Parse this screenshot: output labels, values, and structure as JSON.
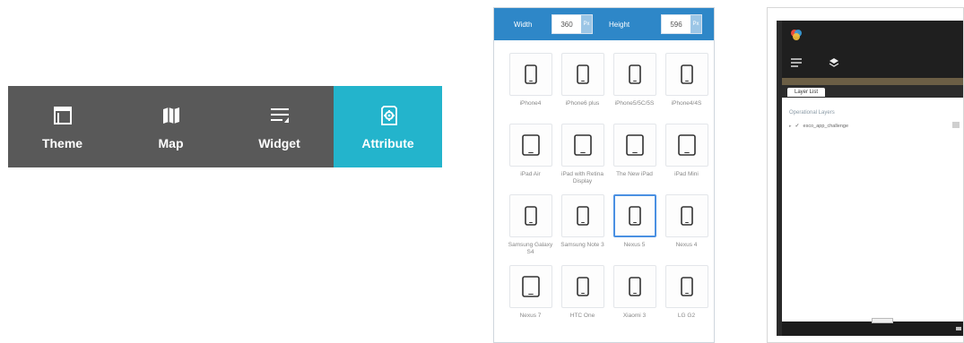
{
  "tabs": [
    {
      "label": "Theme",
      "icon": "theme-icon",
      "active": false
    },
    {
      "label": "Map",
      "icon": "map-icon",
      "active": false
    },
    {
      "label": "Widget",
      "icon": "widget-icon",
      "active": false
    },
    {
      "label": "Attribute",
      "icon": "attribute-gear-icon",
      "active": true
    }
  ],
  "size_bar": {
    "width_label": "Width",
    "width_value": "360",
    "width_unit": "Px",
    "height_label": "Height",
    "height_value": "596",
    "height_unit": "Px"
  },
  "devices": [
    {
      "label": "iPhone4",
      "type": "phone"
    },
    {
      "label": "iPhone6 plus",
      "type": "phone"
    },
    {
      "label": "iPhone5/5C/5S",
      "type": "phone"
    },
    {
      "label": "iPhone4/4S",
      "type": "phone"
    },
    {
      "label": "iPad Air",
      "type": "tablet"
    },
    {
      "label": "iPad with Retina Display",
      "type": "tablet"
    },
    {
      "label": "The New iPad",
      "type": "tablet"
    },
    {
      "label": "iPad Mini",
      "type": "tablet"
    },
    {
      "label": "Samsung Galaxy S4",
      "type": "phone"
    },
    {
      "label": "Samsung Note 3",
      "type": "phone"
    },
    {
      "label": "Nexus 5",
      "type": "phone",
      "selected": true
    },
    {
      "label": "Nexus 4",
      "type": "phone"
    },
    {
      "label": "Nexus 7",
      "type": "tablet"
    },
    {
      "label": "HTC One",
      "type": "phone"
    },
    {
      "label": "Xiaomi 3",
      "type": "phone"
    },
    {
      "label": "LG G2",
      "type": "phone"
    }
  ],
  "preview": {
    "tab_label": "Layer List",
    "section_title": "Operational Layers",
    "layer_name": "esco_app_challenge"
  },
  "colors": {
    "tabbar_bg": "#595959",
    "tab_active_bg": "#23b4cc",
    "size_bar_bg": "#2e87c8",
    "selected_border": "#4a90e2"
  }
}
